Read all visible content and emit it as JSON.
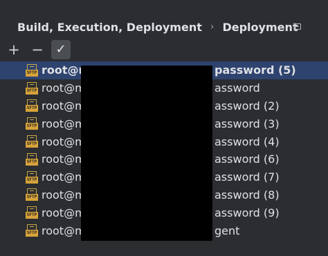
{
  "breadcrumb": {
    "parent": "Build, Execution, Deployment",
    "current": "Deployment"
  },
  "toolbar": {
    "add": "+",
    "remove": "−",
    "apply": "✓"
  },
  "servers": [
    {
      "prefix": "root@m",
      "suffix": "password (5)",
      "icon_tag": "SFTP"
    },
    {
      "prefix": "root@m",
      "suffix": "assword",
      "icon_tag": "SFTP"
    },
    {
      "prefix": "root@m",
      "suffix": "assword (2)",
      "icon_tag": "SFTP"
    },
    {
      "prefix": "root@m",
      "suffix": "assword (3)",
      "icon_tag": "SFTP"
    },
    {
      "prefix": "root@m",
      "suffix": "assword (4)",
      "icon_tag": "SFTP"
    },
    {
      "prefix": "root@m",
      "suffix": "assword (6)",
      "icon_tag": "SFTP"
    },
    {
      "prefix": "root@m",
      "suffix": "assword (7)",
      "icon_tag": "SFTP"
    },
    {
      "prefix": "root@m",
      "suffix": "assword (8)",
      "icon_tag": "SFTP"
    },
    {
      "prefix": "root@m",
      "suffix": "assword (9)",
      "icon_tag": "SFTP"
    },
    {
      "prefix": "root@m",
      "suffix": "gent",
      "icon_tag": "SFTP"
    }
  ]
}
